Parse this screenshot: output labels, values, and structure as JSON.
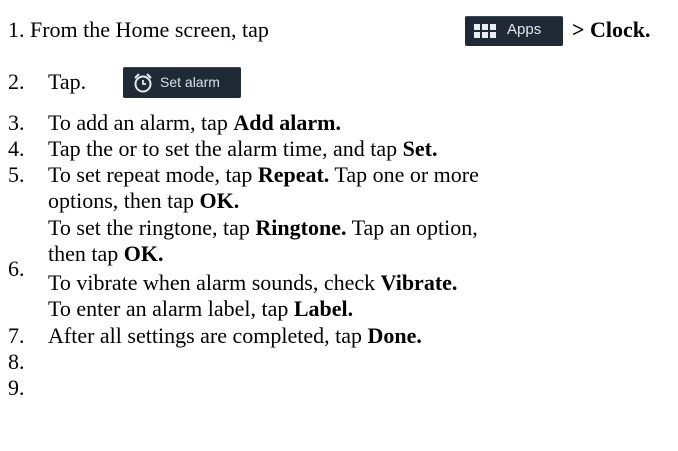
{
  "step1": {
    "intro": "1. From the Home screen, tap",
    "apps_label": "Apps",
    "arrow_text": "> ",
    "clock": "Clock."
  },
  "step2": {
    "num": "2.",
    "text": "Tap.",
    "button_label": "Set alarm"
  },
  "step3": {
    "num": "3.",
    "text": "To add an alarm, tap ",
    "bold": "Add alarm."
  },
  "step4": {
    "num": "4.",
    "text": "Tap the or to set the alarm time, and tap ",
    "bold": "Set."
  },
  "step5": {
    "num": "5.",
    "line1_text": "To set repeat mode, tap ",
    "line1_bold": "Repeat.",
    "line1_tail": " Tap one or more",
    "line2_text": "options, then tap ",
    "line2_bold": "OK."
  },
  "step6": {
    "num": "6.",
    "line1_text": "To set the ringtone, tap ",
    "line1_bold": "Ringtone.",
    "line1_tail": " Tap an option,",
    "line2_text": "then tap ",
    "line2_bold": "OK.",
    "line3_text": "To vibrate when alarm sounds, check ",
    "line3_bold": "Vibrate.",
    "line4_text": "To enter an alarm label, tap ",
    "line4_bold": "Label."
  },
  "step7": {
    "num": "7.",
    "text": "After all settings are completed, tap ",
    "bold": "Done."
  },
  "step8": {
    "num": "8."
  },
  "step9": {
    "num": "9."
  }
}
